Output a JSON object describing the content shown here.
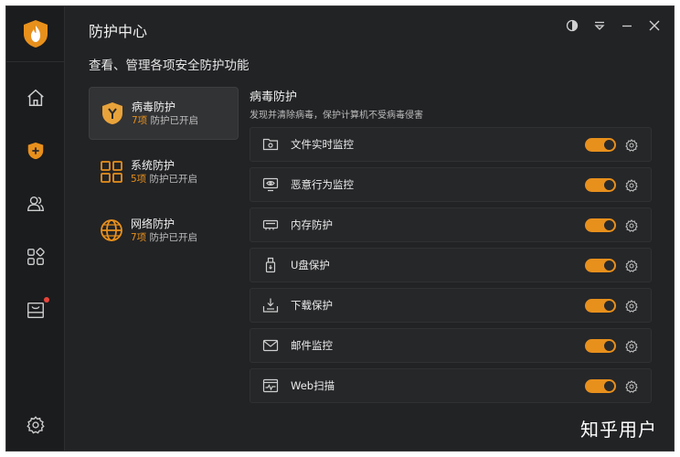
{
  "window": {
    "title": "防护中心",
    "subtitle": "查看、管理各项安全防护功能"
  },
  "rail": {
    "items": [
      "home-icon",
      "shield-plus-icon",
      "users-icon",
      "apps-icon",
      "store-icon",
      "settings-icon"
    ]
  },
  "window_controls": [
    "theme-icon",
    "menu-icon",
    "minimize-icon",
    "close-icon"
  ],
  "categories": [
    {
      "name": "病毒防护",
      "count": "7项",
      "status": "防护已开启",
      "active": true
    },
    {
      "name": "系统防护",
      "count": "5项",
      "status": "防护已开启",
      "active": false
    },
    {
      "name": "网络防护",
      "count": "7项",
      "status": "防护已开启",
      "active": false
    }
  ],
  "panel": {
    "title": "病毒防护",
    "description": "发现并清除病毒，保护计算机不受病毒侵害",
    "items": [
      {
        "label": "文件实时监控",
        "enabled": true,
        "icon": "folder-monitor-icon"
      },
      {
        "label": "恶意行为监控",
        "enabled": true,
        "icon": "eye-monitor-icon"
      },
      {
        "label": "内存防护",
        "enabled": true,
        "icon": "memory-icon"
      },
      {
        "label": "U盘保护",
        "enabled": true,
        "icon": "usb-icon"
      },
      {
        "label": "下载保护",
        "enabled": true,
        "icon": "download-icon"
      },
      {
        "label": "邮件监控",
        "enabled": true,
        "icon": "mail-icon"
      },
      {
        "label": "Web扫描",
        "enabled": true,
        "icon": "web-scan-icon"
      }
    ]
  },
  "colors": {
    "accent": "#e8901c",
    "background": "#222325",
    "rail": "#1b1c1e"
  },
  "watermark": "知乎用户"
}
